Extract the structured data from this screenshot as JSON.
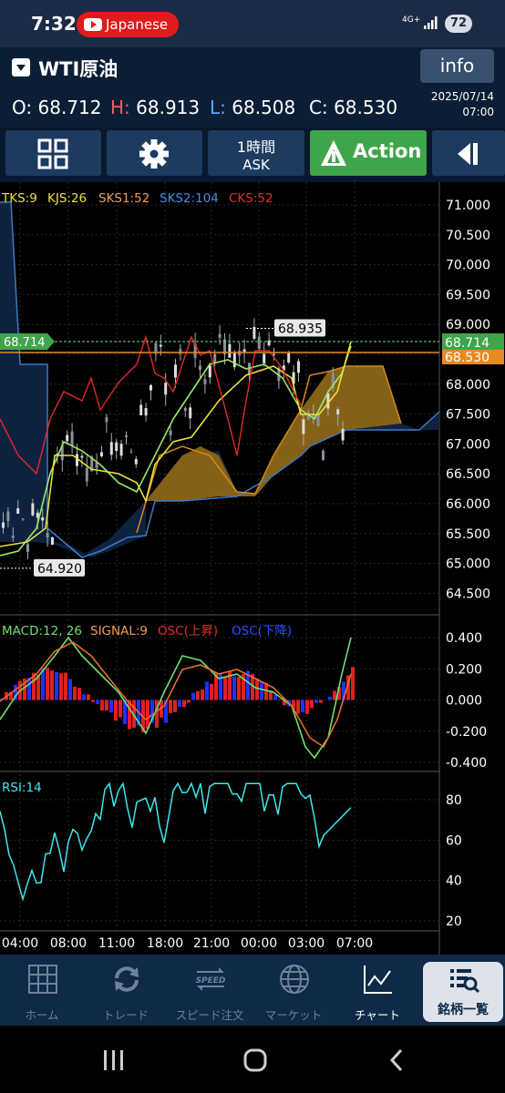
{
  "status_bar": {
    "time": "7:32",
    "notification_pill": "Japanese",
    "network": "4G+",
    "battery": "72"
  },
  "header": {
    "symbol": "WTI原油",
    "info_button": "info",
    "ohlc": {
      "o_label": "O:",
      "o_value": "68.712",
      "h_label": "H:",
      "h_value": "68.913",
      "l_label": "L:",
      "l_value": "68.508",
      "c_label": "C:",
      "c_value": "68.530"
    },
    "date": "2025/07/14",
    "time": "07:00"
  },
  "toolbar": {
    "timeframe_line1": "1時間",
    "timeframe_line2": "ASK",
    "action_label": "Action"
  },
  "colors": {
    "header_bg": "#0b1e36",
    "toolbar_btn": "#1d3a5f",
    "action_green": "#3fa54a",
    "kijun": "#e8e040",
    "tenkan": "#9be86a",
    "chikou": "#e22828",
    "cloud": "#c4901a",
    "senkou_b": "#3d7bc4",
    "rsi": "#3ee8ee"
  },
  "main_chart": {
    "legend": {
      "tks": "TKS:9",
      "kjs": "KJS:26",
      "sks1": "SKS1:52",
      "sks2": "SKS2:104",
      "cks": "CKS:52"
    },
    "y_ticks": [
      "71.000",
      "70.500",
      "70.000",
      "69.500",
      "69.000",
      "68.500",
      "68.000",
      "67.500",
      "67.000",
      "66.500",
      "66.000",
      "65.500",
      "65.000",
      "64.500"
    ],
    "current_price_tag": "68.714",
    "close_price_tag": "68.530",
    "high_marker": "68.935",
    "low_marker": "64.920"
  },
  "macd": {
    "legend": {
      "macd": "MACD:12, 26",
      "signal": "SIGNAL:9",
      "osc_up": "OSC(上昇)",
      "osc_down": "OSC(下降)"
    },
    "y_ticks": [
      "0.400",
      "0.200",
      "0.000",
      "-0.200",
      "-0.400"
    ]
  },
  "rsi": {
    "legend": "RSI:14",
    "y_ticks": [
      "80",
      "60",
      "40",
      "20"
    ]
  },
  "x_ticks": [
    "04:00",
    "08:00",
    "11:00",
    "18:00",
    "21:00",
    "00:00",
    "03:00",
    "07:00"
  ],
  "bottom_nav": [
    {
      "label": "ホーム",
      "icon": "grid-icon"
    },
    {
      "label": "トレード",
      "icon": "refresh-arrows-icon"
    },
    {
      "label": "スピード注文",
      "icon": "speed-icon"
    },
    {
      "label": "マーケット",
      "icon": "globe-icon"
    },
    {
      "label": "チャート",
      "icon": "chart-icon"
    },
    {
      "label": "銘柄一覧",
      "icon": "list-icon"
    }
  ],
  "speed_icon_text": "SPEED"
}
